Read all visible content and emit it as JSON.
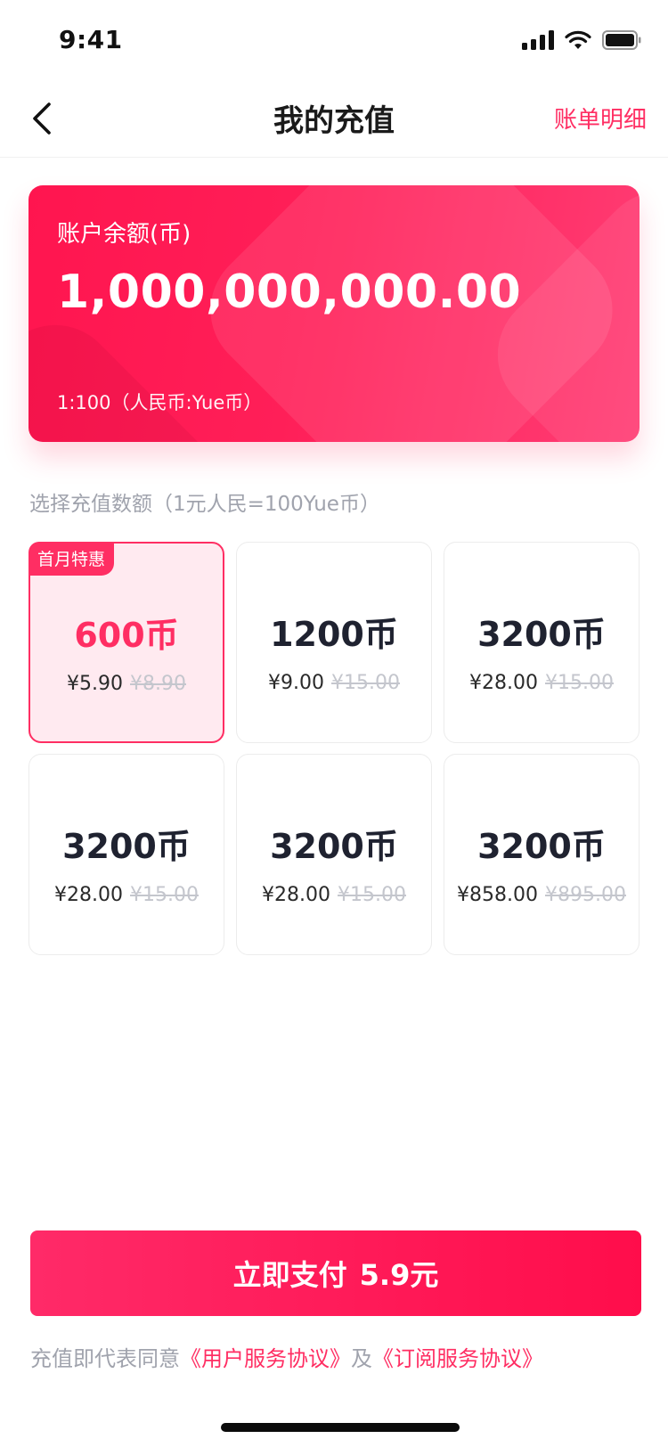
{
  "status_bar": {
    "time": "9:41"
  },
  "nav": {
    "title": "我的充值",
    "right_link": "账单明细"
  },
  "balance": {
    "label": "账户余额(币)",
    "amount": "1,000,000,000.00",
    "rate": "1:100（人民币:Yue币）"
  },
  "section_label": "选择充值数额（1元人民=100Yue币）",
  "options": [
    {
      "tag": "首月特惠",
      "coins": "600币",
      "price": "¥5.90",
      "original_price": "¥8.90",
      "selected": true
    },
    {
      "coins": "1200币",
      "price": "¥9.00",
      "original_price": "¥15.00"
    },
    {
      "coins": "3200币",
      "price": "¥28.00",
      "original_price": "¥15.00"
    },
    {
      "coins": "3200币",
      "price": "¥28.00",
      "original_price": "¥15.00"
    },
    {
      "coins": "3200币",
      "price": "¥28.00",
      "original_price": "¥15.00"
    },
    {
      "coins": "3200币",
      "price": "¥858.00",
      "original_price": "¥895.00"
    }
  ],
  "pay_button": {
    "label": "立即支付",
    "amount": "5.9元"
  },
  "agreement": {
    "prefix": "充值即代表同意",
    "link1": "《用户服务协议》",
    "middle": "及",
    "link2": "《订阅服务协议》"
  },
  "colors": {
    "accent": "#ff2e63",
    "card_start": "#ff154f",
    "card_end": "#ff3d74"
  }
}
